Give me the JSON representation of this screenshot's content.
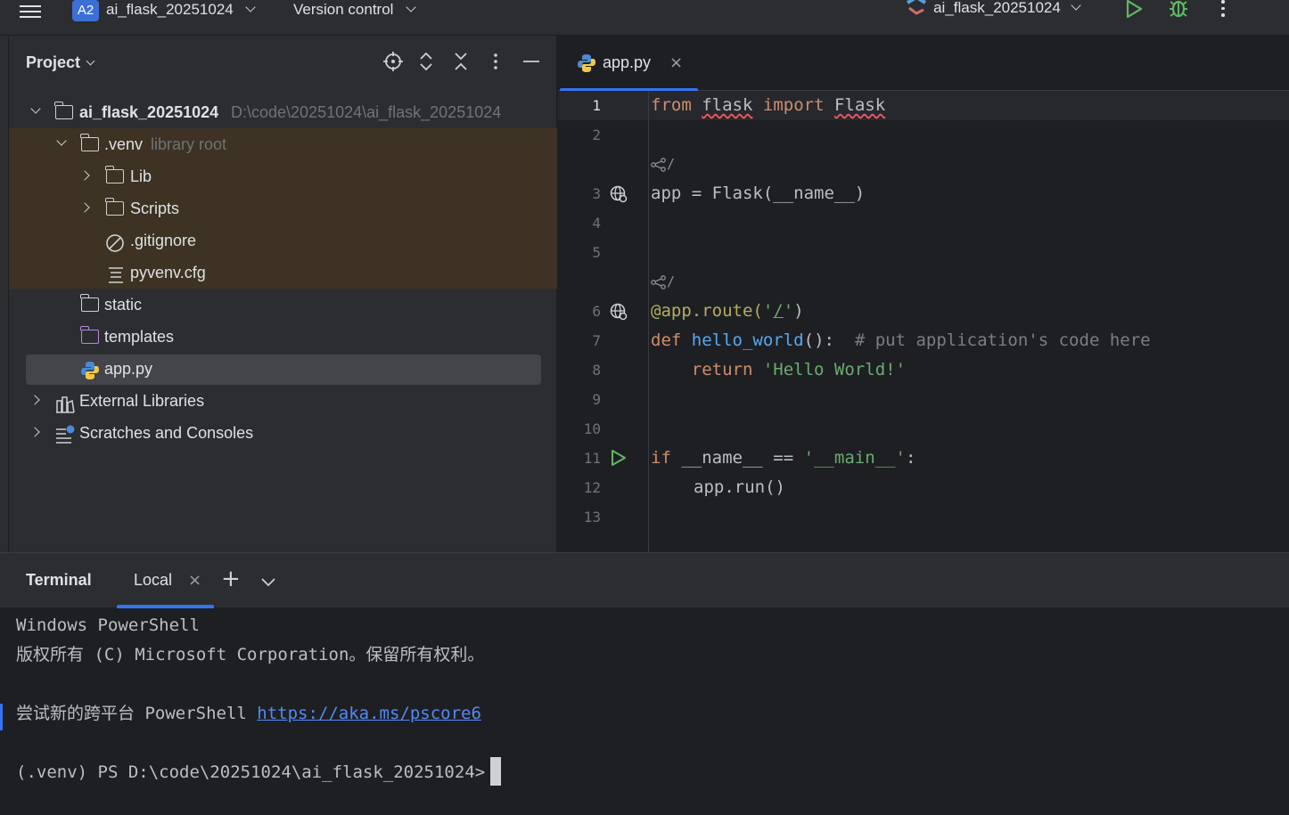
{
  "topbar": {
    "project_badge": "A2",
    "project_name": "ai_flask_20251024",
    "vcs_label": "Version control",
    "run_config": "ai_flask_20251024"
  },
  "project_panel": {
    "title": "Project",
    "tree": {
      "root_name": "ai_flask_20251024",
      "root_path": "D:\\code\\20251024\\ai_flask_20251024",
      "venv_name": ".venv",
      "venv_hint": "library root",
      "lib": "Lib",
      "scripts": "Scripts",
      "gitignore": ".gitignore",
      "pyvenv": "pyvenv.cfg",
      "static": "static",
      "templates": "templates",
      "app": "app.py",
      "external": "External Libraries",
      "scratches": "Scratches and Consoles"
    }
  },
  "editor": {
    "tab_label": "app.py",
    "tab_close": "×",
    "line_numbers": [
      "1",
      "2",
      "3",
      "4",
      "5",
      "6",
      "7",
      "8",
      "9",
      "10",
      "11",
      "12",
      "13"
    ],
    "code": {
      "l1_from": "from",
      "l1_flask": "flask",
      "l1_import": "import",
      "l1_Flask": "Flask",
      "hint_route": "/",
      "l3_app": "app = Flask(__name__)",
      "l6_deco": "@app.route(",
      "l6_q1": "'",
      "l6_path": "/",
      "l6_q2": "'",
      "l6_close": ")",
      "l7_def": "def",
      "l7_fn": "hello_world",
      "l7_paren": "():",
      "l7_comment": "# put application's code here",
      "l8_return": "return",
      "l8_str": "'Hello World!'",
      "l11_if": "if",
      "l11_rest": " __name__ == ",
      "l11_str": "'__main__'",
      "l11_colon": ":",
      "l12": "app.run()"
    }
  },
  "terminal": {
    "title": "Terminal",
    "tab_label": "Local",
    "tab_close": "×",
    "plus": "+",
    "lines": {
      "l1": "Windows PowerShell",
      "l2": "版权所有 (C) Microsoft Corporation。保留所有权利。",
      "l3_prefix": "尝试新的跨平台 PowerShell ",
      "l3_link": "https://aka.ms/pscore6",
      "prompt": "(.venv) PS D:\\code\\20251024\\ai_flask_20251024>"
    }
  },
  "colors": {
    "accent": "#3574f0",
    "keyword": "#cf8e6d",
    "function": "#56a8f5",
    "string": "#6aab73",
    "run_green": "#5fb865"
  },
  "icons": [
    "menu-icon",
    "chevron-down-icon",
    "run-icon",
    "debug-icon",
    "more-icon",
    "locate-icon",
    "expand-icon",
    "collapse-icon",
    "minimize-icon",
    "folder-icon",
    "python-icon",
    "ignore-icon",
    "config-file-icon",
    "library-icon",
    "scratch-icon",
    "web-globe-icon",
    "share-icon",
    "close-icon",
    "plus-icon"
  ]
}
